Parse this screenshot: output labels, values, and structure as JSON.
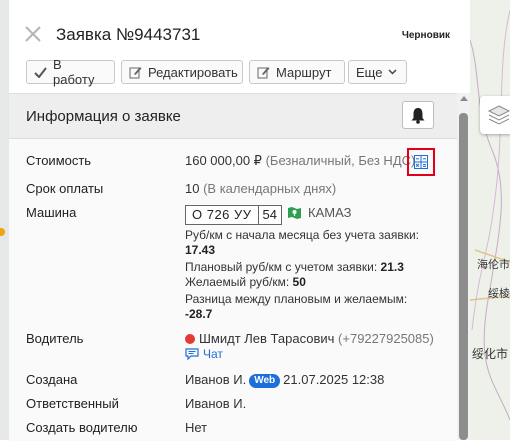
{
  "header": {
    "title": "Заявка №9443731",
    "status": "Черновик"
  },
  "toolbar": {
    "to_work_label": "В работу",
    "edit_label": "Редактировать",
    "route_label": "Маршрут",
    "more_label": "Еще"
  },
  "section": {
    "title": "Информация о заявке"
  },
  "fields": {
    "cost_label": "Стоимость",
    "cost_value": "160 000,00 ₽",
    "cost_note": "(Безналичный, Без НДС)",
    "payment_term_label": "Срок оплаты",
    "payment_term_value": "10",
    "payment_term_note": "(В календарных днях)",
    "vehicle_label": "Машина",
    "plate_number": "О 726 УУ",
    "plate_region": "54",
    "vehicle_brand": "КАМАЗ",
    "metric1_text": "Руб/км с начала месяца без учета заявки:",
    "metric1_value": "17.43",
    "metric2_text": "Плановый руб/км с учетом заявки:",
    "metric2_value": "21.3",
    "metric3_text": "Желаемый руб/км:",
    "metric3_value": "50",
    "metric4_text": "Разница между плановым и желаемым:",
    "metric4_value": "-28.7",
    "driver_label": "Водитель",
    "driver_name": "Шмидт Лев Тарасович",
    "driver_phone": "(+79227925085)",
    "chat_label": "Чат",
    "created_label": "Создана",
    "created_by": "Иванов И.",
    "created_badge": "Web",
    "created_at": "21.07.2025 12:38",
    "responsible_label": "Ответственный",
    "responsible_value": "Иванов И.",
    "create_driver_label": "Создать водителю",
    "create_driver_value": "Нет"
  },
  "map": {
    "label1": "海伦市",
    "label2": "绥棱",
    "label3": "绥化市"
  },
  "colors": {
    "accent": "#1e6fd9",
    "highlight_border": "#e0001a",
    "driver_status": "#e53935",
    "truck_icon": "#2e9e4f"
  }
}
